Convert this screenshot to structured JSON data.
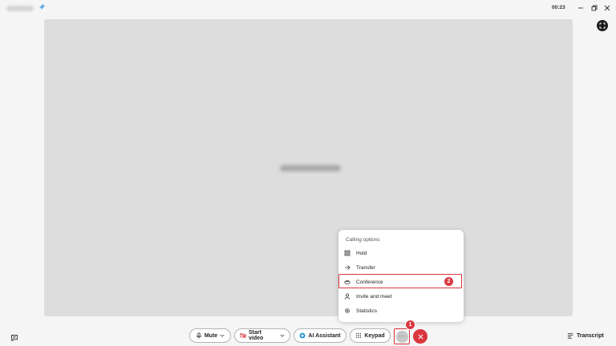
{
  "titlebar": {
    "timer": "00:23"
  },
  "calling_menu": {
    "heading": "Calling options",
    "items": [
      {
        "label": "Hold",
        "icon": "hold-icon"
      },
      {
        "label": "Transfer",
        "icon": "arrow-right-icon"
      },
      {
        "label": "Conference",
        "icon": "conference-icon"
      },
      {
        "label": "Invite and meet",
        "icon": "person-icon"
      },
      {
        "label": "Statistics",
        "icon": "gear-icon"
      }
    ]
  },
  "annotations": {
    "step_1": "1",
    "step_2": "2"
  },
  "toolbar": {
    "mute_label": "Mute",
    "start_video_label": "Start video",
    "ai_assistant_label": "AI Assistant",
    "keypad_label": "Keypad",
    "more_label": "···",
    "transcript_label": "Transcript"
  },
  "colors": {
    "end_call": "#d9363e",
    "annotation": "#d9363e",
    "stage_bg": "#dddddd",
    "window_bg": "#f5f5f5"
  }
}
